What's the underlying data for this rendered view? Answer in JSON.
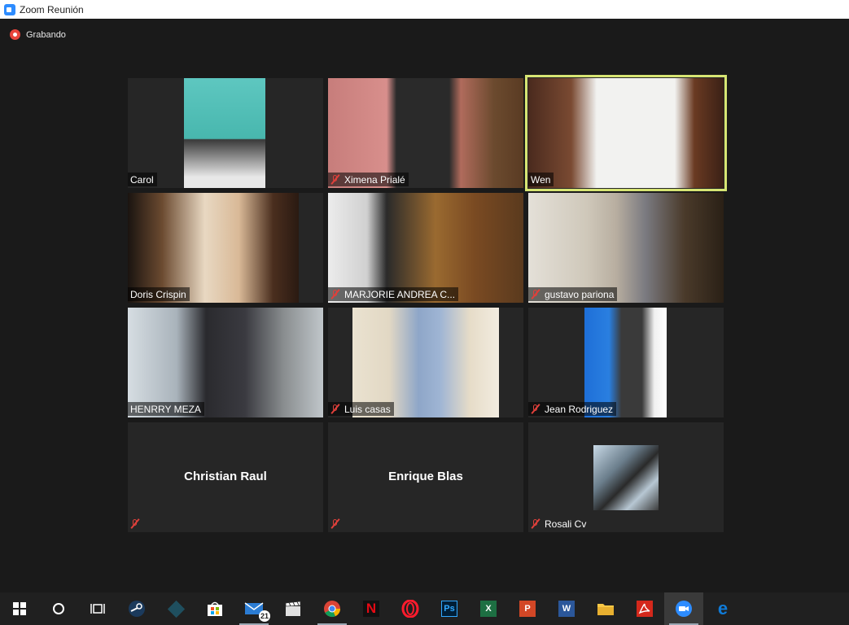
{
  "window": {
    "title": "Zoom Reunión"
  },
  "recording": {
    "label": "Grabando",
    "color": "#e8453c"
  },
  "active_speaker_color": "#d7e573",
  "participants": [
    {
      "name": "Carol",
      "muted": false,
      "video": true,
      "active": false
    },
    {
      "name": "Ximena Prialé",
      "muted": true,
      "video": true,
      "active": false
    },
    {
      "name": "Wen",
      "muted": false,
      "video": true,
      "active": true
    },
    {
      "name": "Doris Crispin",
      "muted": false,
      "video": true,
      "active": false
    },
    {
      "name": "MARJORIE ANDREA C...",
      "muted": true,
      "video": true,
      "active": false
    },
    {
      "name": "gustavo pariona",
      "muted": true,
      "video": true,
      "active": false
    },
    {
      "name": "HENRRY MEZA",
      "muted": false,
      "video": true,
      "active": false
    },
    {
      "name": "Luis casas",
      "muted": true,
      "video": true,
      "active": false
    },
    {
      "name": "Jean Rodriguez",
      "muted": true,
      "video": true,
      "active": false
    },
    {
      "name": "Christian Raul",
      "muted": true,
      "video": false,
      "active": false
    },
    {
      "name": "Enrique Blas",
      "muted": true,
      "video": false,
      "active": false
    },
    {
      "name": "Rosali Cv",
      "muted": true,
      "video": false,
      "avatar": true,
      "active": false
    }
  ],
  "taskbar": {
    "items": [
      {
        "icon": "windows-start-icon"
      },
      {
        "icon": "search-circle-icon"
      },
      {
        "icon": "task-view-icon"
      },
      {
        "icon": "steam-icon"
      },
      {
        "icon": "filmora-icon"
      },
      {
        "icon": "microsoft-store-icon"
      },
      {
        "icon": "mail-icon",
        "badge": "21"
      },
      {
        "icon": "clapperboard-icon"
      },
      {
        "icon": "chrome-icon"
      },
      {
        "icon": "netflix-icon",
        "text": "N"
      },
      {
        "icon": "opera-icon",
        "text": "O"
      },
      {
        "icon": "photoshop-icon",
        "text": "Ps"
      },
      {
        "icon": "excel-icon",
        "text": "X"
      },
      {
        "icon": "powerpoint-icon",
        "text": "P"
      },
      {
        "icon": "word-icon",
        "text": "W"
      },
      {
        "icon": "file-explorer-icon"
      },
      {
        "icon": "acrobat-icon"
      },
      {
        "icon": "zoom-icon"
      },
      {
        "icon": "edge-icon",
        "text": "e"
      }
    ]
  }
}
